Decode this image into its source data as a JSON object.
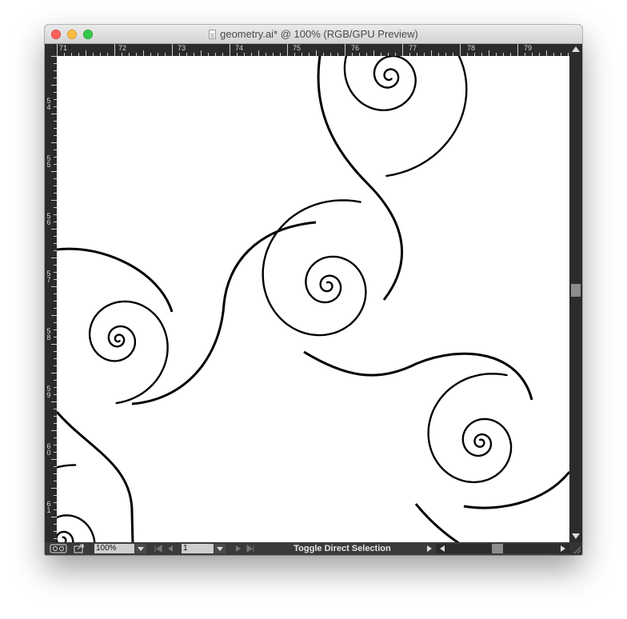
{
  "window": {
    "title": "geometry.ai* @ 100% (RGB/GPU Preview)"
  },
  "ruler": {
    "horizontal_labels": [
      "71",
      "72",
      "73",
      "74",
      "75",
      "76",
      "77",
      "78",
      "79"
    ],
    "vertical_labels": [
      "54",
      "55",
      "56",
      "57",
      "58",
      "59",
      "60",
      "61"
    ]
  },
  "artwork": {
    "stroke_color": "#000000",
    "shapes": [
      "spiral",
      "spiral",
      "spiral",
      "spiral",
      "spiral",
      "spiral"
    ]
  },
  "statusbar": {
    "zoom_value": "100%",
    "page_value": "1",
    "status_text": "Toggle Direct Selection"
  },
  "colors": {
    "chrome": "#2f2f2f",
    "titlebar": "#e0e0e0",
    "close": "#fc605b",
    "minimize": "#fdbc40",
    "maximize": "#34c84a"
  }
}
